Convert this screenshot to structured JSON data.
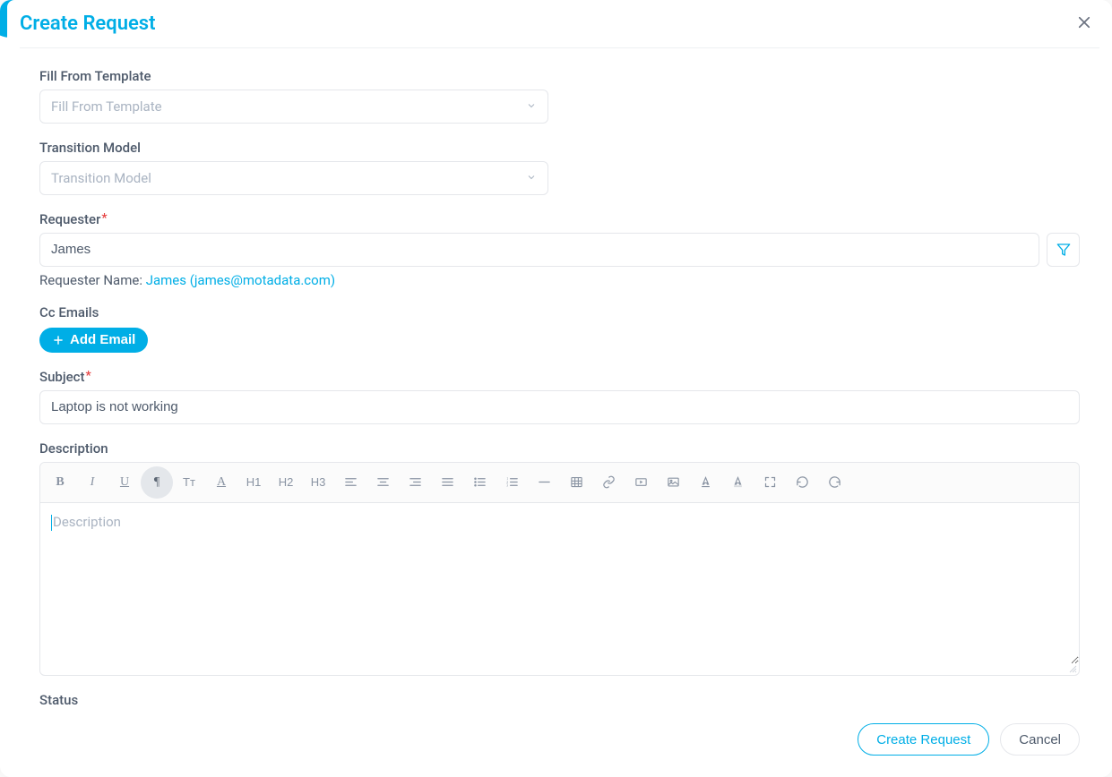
{
  "header": {
    "title": "Create Request"
  },
  "fill_from_template": {
    "label": "Fill From Template",
    "placeholder": "Fill From Template"
  },
  "transition_model": {
    "label": "Transition Model",
    "placeholder": "Transition Model"
  },
  "requester": {
    "label": "Requester",
    "value": "James",
    "name_prefix": "Requester Name: ",
    "name_link": "James (james@motadata.com)"
  },
  "cc_emails": {
    "label": "Cc Emails",
    "add_button": "Add Email"
  },
  "subject": {
    "label": "Subject",
    "value": "Laptop is not working"
  },
  "description": {
    "label": "Description",
    "placeholder": "Description"
  },
  "toolbar": {
    "bold": "B",
    "italic": "I",
    "underline": "U",
    "paragraph": "¶",
    "textsize": "Tт",
    "textcolor": "A",
    "h1": "H1",
    "h2": "H2",
    "h3": "H3"
  },
  "status": {
    "label": "Status"
  },
  "footer": {
    "create": "Create Request",
    "cancel": "Cancel"
  }
}
